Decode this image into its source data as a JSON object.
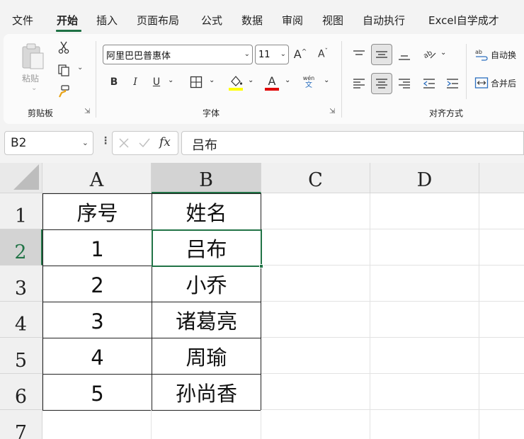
{
  "menu": {
    "items": [
      "文件",
      "开始",
      "插入",
      "页面布局",
      "公式",
      "数据",
      "审阅",
      "视图",
      "自动执行",
      "Excel自学成才"
    ],
    "active_index": 1
  },
  "ribbon": {
    "clipboard": {
      "paste_label": "粘贴",
      "group_label": "剪贴板"
    },
    "font": {
      "font_name": "阿里巴巴普惠体",
      "font_size": "11",
      "bold": "B",
      "italic": "I",
      "underline": "U",
      "group_label": "字体",
      "phonetic_top": "wén",
      "phonetic_bottom": "文",
      "highlight_color": "#ffff00",
      "font_color": "#e00000"
    },
    "alignment": {
      "wrap_text": "自动换",
      "merge_center": "合并后",
      "group_label": "对齐方式"
    }
  },
  "formula_bar": {
    "name_box": "B2",
    "fx_label": "fx",
    "value": "吕布"
  },
  "sheet": {
    "columns": [
      "A",
      "B",
      "C",
      "D"
    ],
    "rows": [
      "1",
      "2",
      "3",
      "4",
      "5",
      "6",
      "7"
    ],
    "selected_cell": "B2",
    "data": [
      [
        "序号",
        "姓名"
      ],
      [
        "1",
        "吕布"
      ],
      [
        "2",
        "小乔"
      ],
      [
        "3",
        "诸葛亮"
      ],
      [
        "4",
        "周瑜"
      ],
      [
        "5",
        "孙尚香"
      ]
    ],
    "accent_color": "#217346"
  }
}
